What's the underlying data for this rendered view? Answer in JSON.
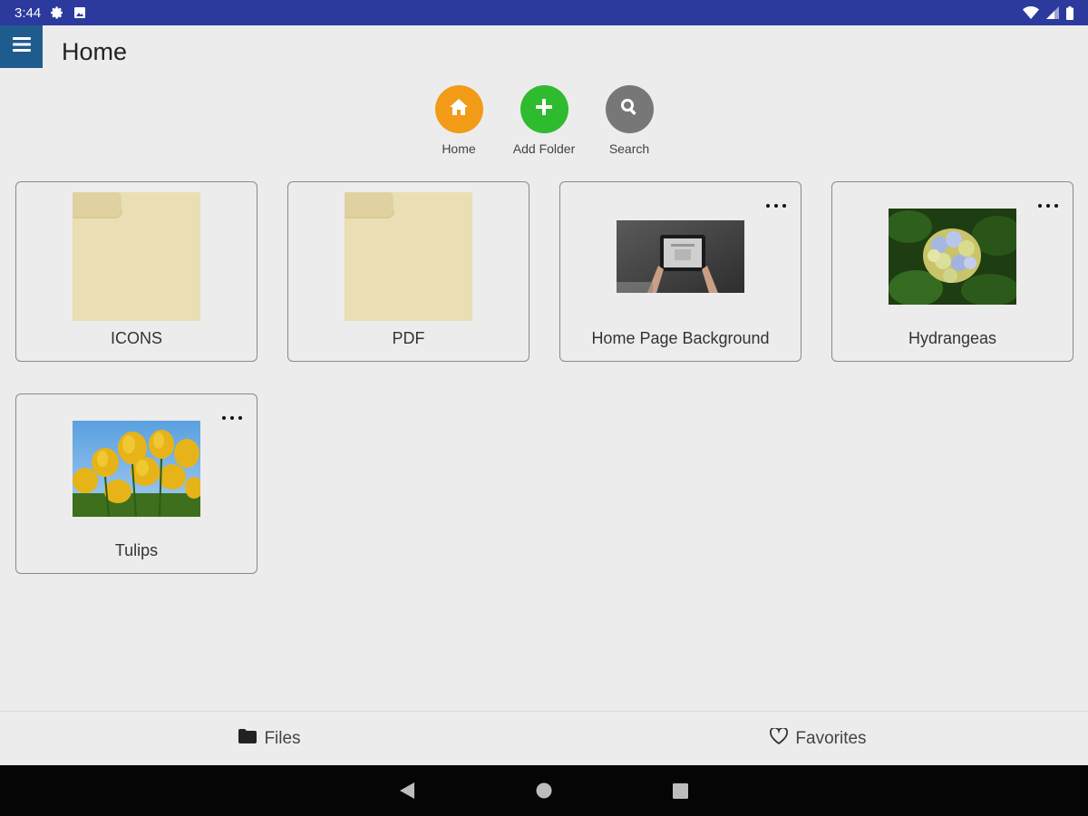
{
  "status_bar": {
    "time": "3:44"
  },
  "app_bar": {
    "title": "Home"
  },
  "quick_actions": [
    {
      "label": "Home",
      "color": "#f29b16",
      "icon": "home-icon"
    },
    {
      "label": "Add Folder",
      "color": "#2fbb2f",
      "icon": "plus-icon"
    },
    {
      "label": "Search",
      "color": "#777777",
      "icon": "search-icon"
    }
  ],
  "items": [
    {
      "label": "ICONS",
      "type": "folder"
    },
    {
      "label": "PDF",
      "type": "folder"
    },
    {
      "label": "Home Page Background",
      "type": "image"
    },
    {
      "label": "Hydrangeas",
      "type": "image"
    },
    {
      "label": "Tulips",
      "type": "image"
    }
  ],
  "bottom_nav": {
    "files_label": "Files",
    "favorites_label": "Favorites"
  },
  "colors": {
    "status_bar": "#2b3a9c",
    "menu_button": "#1f5c8e",
    "folder_fill": "#eadfb4"
  }
}
